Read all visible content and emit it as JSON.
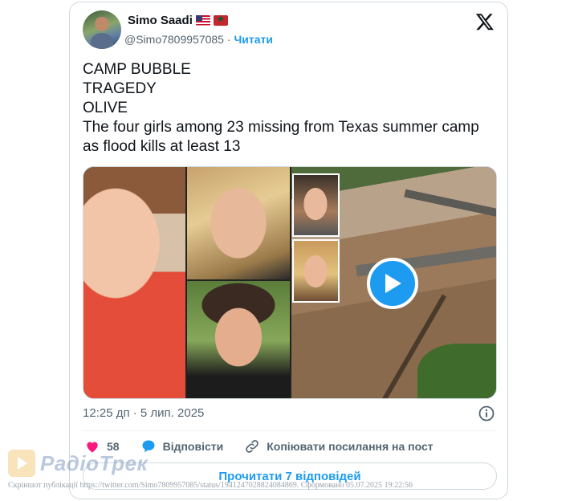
{
  "tweet": {
    "author": {
      "name": "Simo Saadi",
      "flags": [
        "us-flag",
        "morocco-flag"
      ],
      "handle": "@Simo7809957085",
      "separator": "·",
      "follow_label": "Читати"
    },
    "text_lines": [
      "CAMP BUBBLE",
      "TRAGEDY",
      "OLIVE",
      "The four girls among 23 missing from Texas summer camp as flood kills at least 13"
    ],
    "timestamp": "12:25 дп · 5 лип. 2025",
    "media": {
      "type": "video",
      "play_icon": "play-icon"
    },
    "actions": {
      "like_count": "58",
      "reply_label": "Відповісти",
      "copy_link_label": "Копіювати посилання на пост"
    },
    "read_replies_label": "Прочитати 7 відповідей"
  },
  "watermark": {
    "brand": "РадіоТрек"
  },
  "footer": {
    "caption": "Скріншот публікації https://twitter.com/Simo7809957085/status/1941247028824084869. Сформовано 05.07.2025 19:22:56"
  },
  "colors": {
    "accent": "#1d9bf0",
    "like": "#f91880",
    "text_secondary": "#536471",
    "border": "#cfd9de"
  }
}
